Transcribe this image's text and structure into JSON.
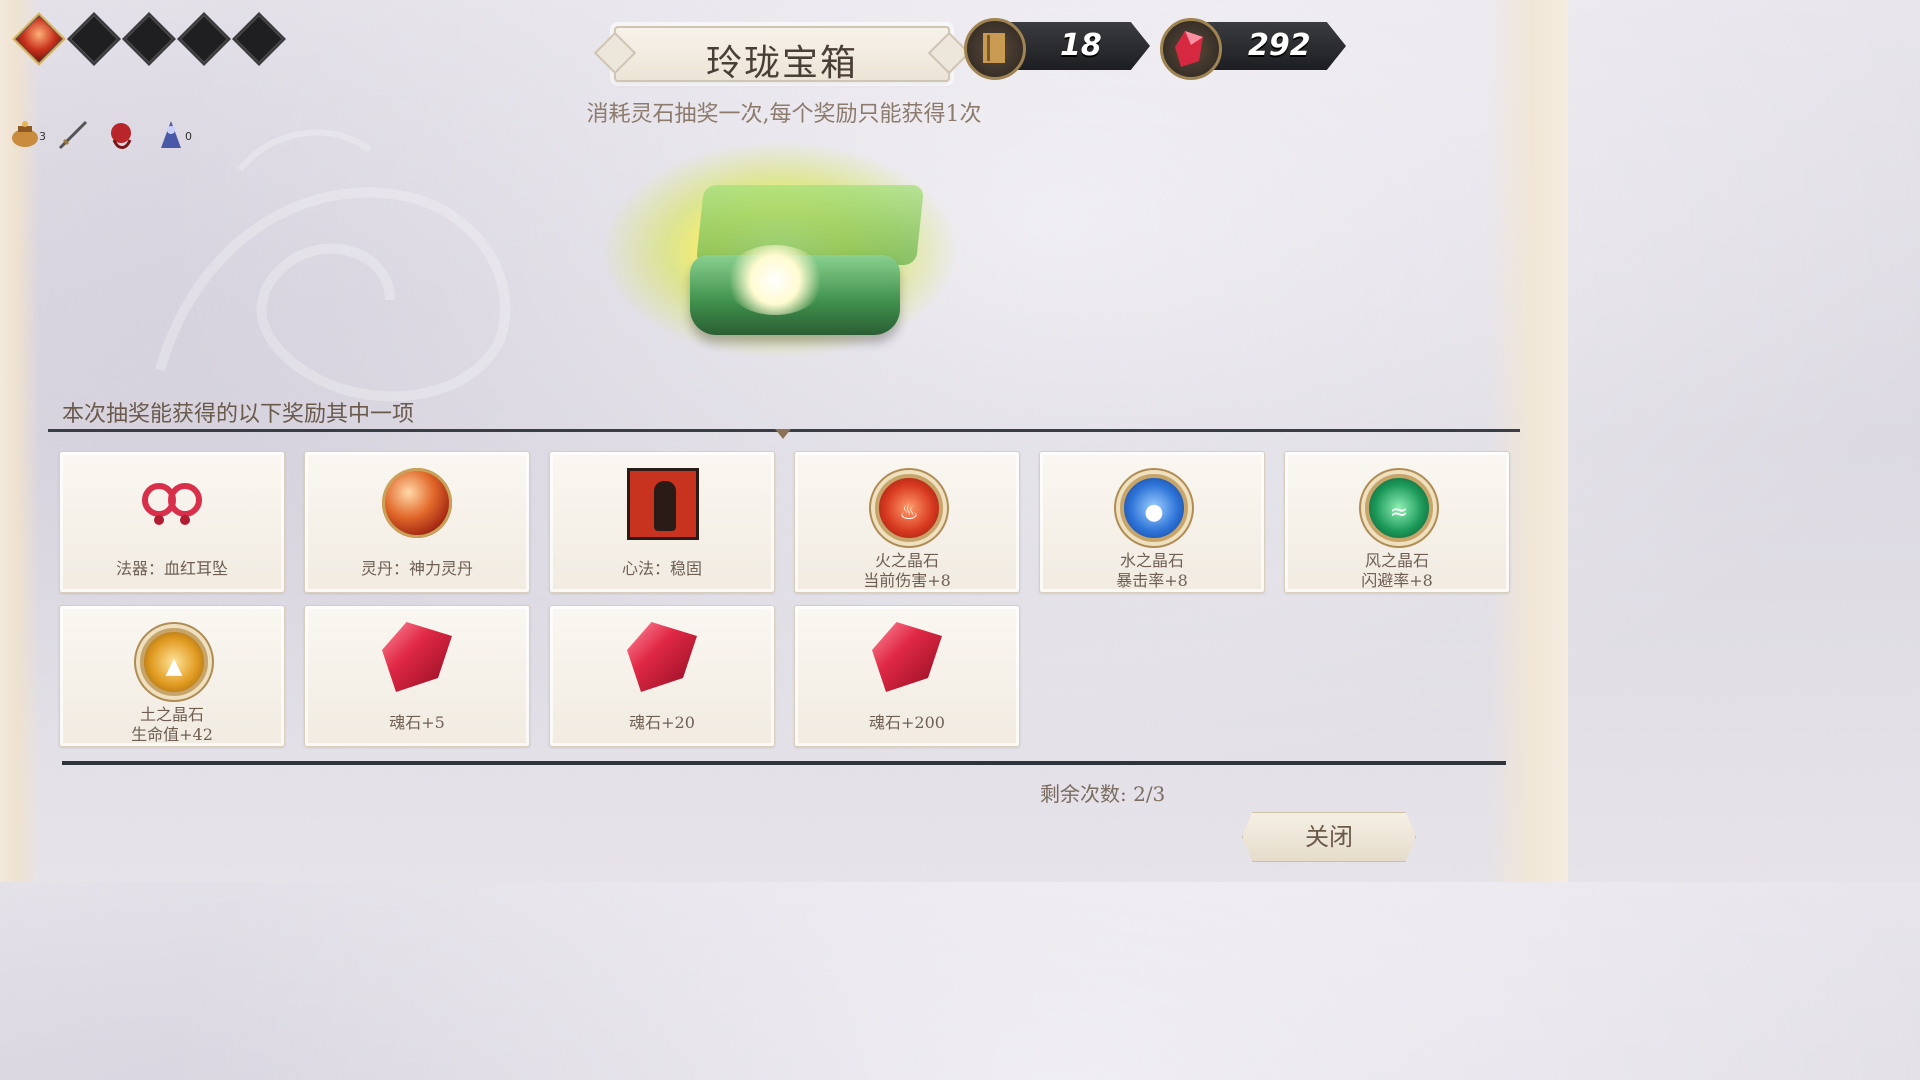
{
  "header": {
    "title": "玲珑宝箱",
    "subtitle": "消耗灵石抽奖一次,每个奖励只能获得1次",
    "progress": {
      "filled": 1,
      "total": 5
    }
  },
  "currencies": [
    {
      "icon": "book-icon",
      "value": "18"
    },
    {
      "icon": "soul-stone-icon",
      "value": "292"
    }
  ],
  "status_icons": [
    {
      "icon": "pot-icon",
      "count": "3"
    },
    {
      "icon": "sword-icon",
      "count": ""
    },
    {
      "icon": "red-sash-icon",
      "count": ""
    },
    {
      "icon": "blue-figure-icon",
      "count": "0"
    }
  ],
  "rewards": {
    "label": "本次抽奖能获得的以下奖励其中一项",
    "items": [
      {
        "icon": "earring-icon",
        "line1": "法器：血红耳坠",
        "line2": ""
      },
      {
        "icon": "red-pill-icon",
        "line1": "灵丹：神力灵丹",
        "line2": ""
      },
      {
        "icon": "mantra-scroll-icon",
        "line1": "心法：稳固",
        "line2": ""
      },
      {
        "icon": "fire-crystal-icon",
        "line1": "火之晶石",
        "line2": "当前伤害+8"
      },
      {
        "icon": "water-crystal-icon",
        "line1": "水之晶石",
        "line2": "暴击率+8"
      },
      {
        "icon": "wind-crystal-icon",
        "line1": "风之晶石",
        "line2": "闪避率+8"
      },
      {
        "icon": "earth-crystal-icon",
        "line1": "土之晶石",
        "line2": "生命值+42"
      },
      {
        "icon": "soul-stone-icon",
        "line1": "魂石+5",
        "line2": ""
      },
      {
        "icon": "soul-stone-icon",
        "line1": "魂石+20",
        "line2": ""
      },
      {
        "icon": "soul-stone-icon",
        "line1": "魂石+200",
        "line2": ""
      }
    ]
  },
  "remaining": "剩余次数: 2/3",
  "close_label": "关闭"
}
